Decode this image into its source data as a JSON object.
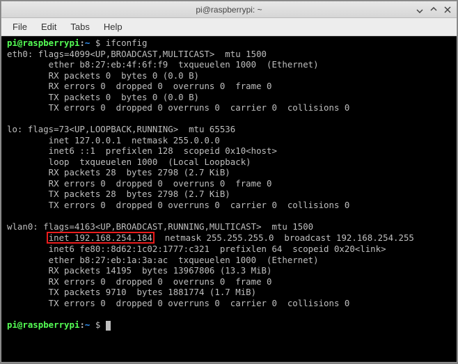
{
  "window": {
    "title": "pi@raspberrypi: ~"
  },
  "menus": {
    "file": "File",
    "edit": "Edit",
    "tabs": "Tabs",
    "help": "Help"
  },
  "prompt": {
    "userhost": "pi@raspberrypi",
    "colon": ":",
    "path": "~",
    "dollar": " $ "
  },
  "cmd": {
    "ifconfig": "ifconfig"
  },
  "output": {
    "eth0_l1": "eth0: flags=4099<UP,BROADCAST,MULTICAST>  mtu 1500",
    "eth0_l2": "        ether b8:27:eb:4f:6f:f9  txqueuelen 1000  (Ethernet)",
    "eth0_l3": "        RX packets 0  bytes 0 (0.0 B)",
    "eth0_l4": "        RX errors 0  dropped 0  overruns 0  frame 0",
    "eth0_l5": "        TX packets 0  bytes 0 (0.0 B)",
    "eth0_l6": "        TX errors 0  dropped 0 overruns 0  carrier 0  collisions 0",
    "blank": " ",
    "lo_l1": "lo: flags=73<UP,LOOPBACK,RUNNING>  mtu 65536",
    "lo_l2": "        inet 127.0.0.1  netmask 255.0.0.0",
    "lo_l3": "        inet6 ::1  prefixlen 128  scopeid 0x10<host>",
    "lo_l4": "        loop  txqueuelen 1000  (Local Loopback)",
    "lo_l5": "        RX packets 28  bytes 2798 (2.7 KiB)",
    "lo_l6": "        RX errors 0  dropped 0  overruns 0  frame 0",
    "lo_l7": "        TX packets 28  bytes 2798 (2.7 KiB)",
    "lo_l8": "        TX errors 0  dropped 0 overruns 0  carrier 0  collisions 0",
    "wlan0_l1": "wlan0: flags=4163<UP,BROADCAST,RUNNING,MULTICAST>  mtu 1500",
    "wlan0_inet_prefix": "        ",
    "wlan0_inet_hilite": "inet 192.168.254.184",
    "wlan0_inet_rest": "  netmask 255.255.255.0  broadcast 192.168.254.255",
    "wlan0_l3": "        inet6 fe80::8d62:1c02:1777:c321  prefixlen 64  scopeid 0x20<link>",
    "wlan0_l4": "        ether b8:27:eb:1a:3a:ac  txqueuelen 1000  (Ethernet)",
    "wlan0_l5": "        RX packets 14195  bytes 13967806 (13.3 MiB)",
    "wlan0_l6": "        RX errors 0  dropped 0  overruns 0  frame 0",
    "wlan0_l7": "        TX packets 9710  bytes 1881774 (1.7 MiB)",
    "wlan0_l8": "        TX errors 0  dropped 0 overruns 0  carrier 0  collisions 0"
  },
  "highlight_color": "#ea1c1c"
}
